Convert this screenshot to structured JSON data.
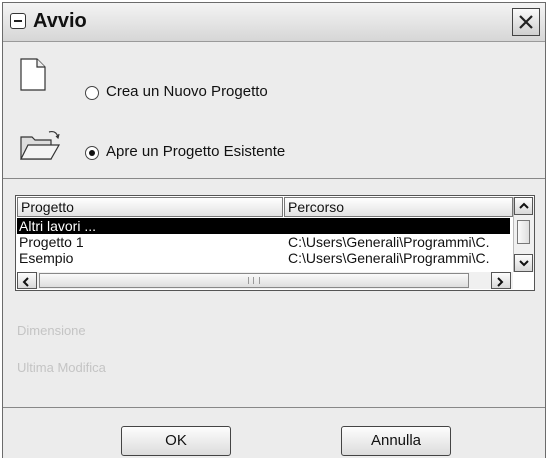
{
  "dialog": {
    "title": "Avvio",
    "options": [
      {
        "label": "Crea un Nuovo Progetto",
        "selected": false,
        "icon": "new-document-icon"
      },
      {
        "label": "Apre un Progetto Esistente",
        "selected": true,
        "icon": "open-folder-icon"
      }
    ]
  },
  "project_list": {
    "columns": [
      "Progetto",
      "Percorso"
    ],
    "rows": [
      {
        "name": "Altri lavori ...",
        "path": "",
        "selected": true
      },
      {
        "name": "Progetto 1",
        "path": "C:\\Users\\Generali\\Programmi\\C.",
        "selected": false
      },
      {
        "name": "Esempio",
        "path": "C:\\Users\\Generali\\Programmi\\C.",
        "selected": false
      }
    ]
  },
  "details": {
    "dimension_label": "Dimensione",
    "last_modified_label": "Ultima Modifica"
  },
  "buttons": {
    "ok": "OK",
    "cancel": "Annulla"
  },
  "colors": {
    "selection": "#000000",
    "disabled_text": "#c4c4c4"
  }
}
